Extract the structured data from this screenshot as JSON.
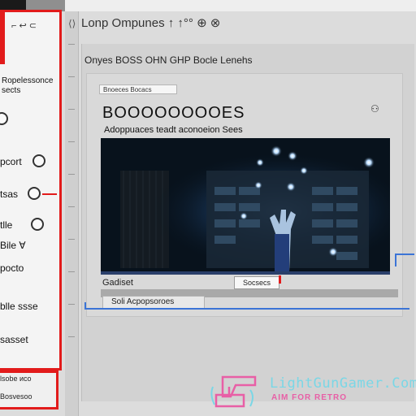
{
  "window": {
    "title": "Lonp Ompunes ↑ ↑°° ⊕ ⊗",
    "header": "Onyes  BOSS  OHN  GHP  Bocle  Lenehs"
  },
  "sidebar": {
    "title": "⌐  ↩ ⊂",
    "items": [
      {
        "label": "Ropelessonce\nsects"
      },
      {
        "label": "◎"
      },
      {
        "label": "pcort"
      },
      {
        "label": "tsas"
      },
      {
        "label": "tlle"
      },
      {
        "label": "Bile ∀"
      },
      {
        "label": "pocto"
      },
      {
        "label": "blle ssse"
      },
      {
        "label": "sasset"
      }
    ],
    "bottom_tab": {
      "line1": "lsobe ᴎco",
      "line2": "Bosvesoo"
    }
  },
  "panel": {
    "address": "Bnoeces  Bocacs",
    "title": "BOOOOOOOOES",
    "subtitle": "Adoppuaces  teadt  aconoeion  Sees",
    "close_glyph": "⚇"
  },
  "status": {
    "label": "Gadiset",
    "select_label": "Socsecs",
    "search_text": "Soli  Acpopsoroes"
  },
  "watermark": {
    "brand": "LightGunGamer.Com",
    "tagline": "AIM FOR RETRO"
  },
  "colors": {
    "accent_red": "#e21b1b",
    "link_blue": "#3b74d6",
    "hero_bg": "#08121c"
  },
  "icons": [
    "chevron-arrows-icon",
    "radio-circle-icon",
    "close-icon",
    "joystick-logo-icon"
  ]
}
